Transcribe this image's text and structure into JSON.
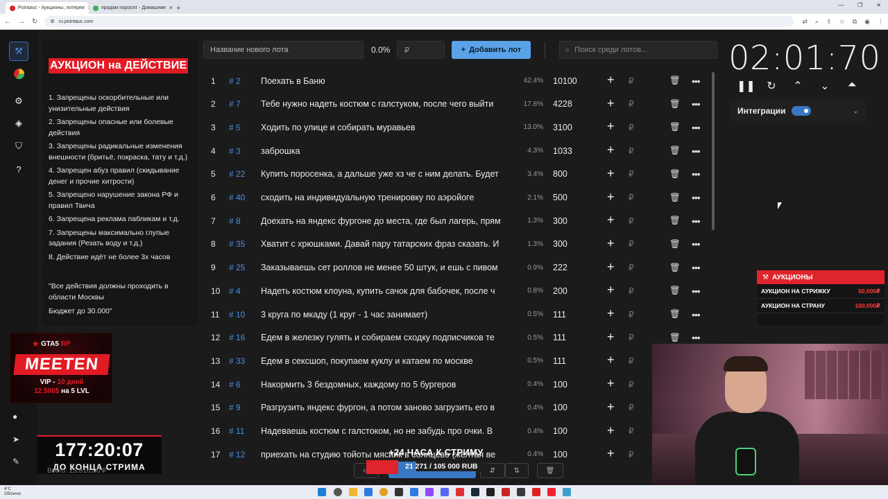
{
  "browser": {
    "tabs": [
      {
        "label": "Pointauc - Аукционы, лотереи",
        "active": true,
        "color": "#e0242c"
      },
      {
        "label": "продам поросят - Домашние",
        "active": false,
        "color": "#3fae5a"
      }
    ],
    "new_tab": "+",
    "url": "ru.pointauc.com",
    "window_controls": [
      "—",
      "❐",
      "✕"
    ]
  },
  "rail": {
    "items": [
      {
        "name": "auction-icon",
        "glyph": "🔨",
        "active": true
      },
      {
        "name": "wheel-icon",
        "glyph": "◕",
        "active": false
      },
      {
        "name": "gear-icon",
        "glyph": "⚙",
        "active": false
      },
      {
        "name": "layers-icon",
        "glyph": "◈",
        "active": false
      },
      {
        "name": "shield-icon",
        "glyph": "⛉",
        "active": false
      },
      {
        "name": "help-icon",
        "glyph": "?",
        "active": false
      }
    ],
    "bottom": [
      {
        "name": "github-icon",
        "glyph": "●"
      },
      {
        "name": "telegram-icon",
        "glyph": "➤"
      },
      {
        "name": "donate-icon",
        "glyph": "✎"
      }
    ]
  },
  "rules": {
    "title": "АУКЦИОН на ДЕЙСТВИЕ",
    "items": [
      "1. Запрещены оскорбительные или унизительные действия",
      "2. Запрещены опасные или болевые действия",
      "3. Запрещены радикальные изменения внешности (бритьё, покраска, тату и т.д.)",
      "4. Запрещен абуз правил (скидывание денег и прочие хитрости)",
      "5. Запрещено нарушение закона РФ и правил Твича",
      "6. Запрещена реклама пабликам и т.д.",
      "7.  Запрещены максимально глупые задания (Резать воду и т.д.)",
      "8. Действие идёт не более 3х часов"
    ],
    "quote": "\"Все действия должны проходить в области Москвы",
    "budget": "Бюджет до 30.000\""
  },
  "promo": {
    "gta": "GTA5",
    "rp": "RP",
    "name": "MEETEN",
    "vip_line1_a": "VIP - ",
    "vip_line1_b": "10 дней",
    "vip_line2_a": "12.500$",
    "vip_line2_b": " на 5 LVL"
  },
  "stream": {
    "countdown": "177:20:07",
    "caption": "ДО КОНЦА СТРИМА",
    "total": "Всего: 23.816,00 ₽"
  },
  "toolbar": {
    "name_placeholder": "Название нового лота",
    "percent": "0.0%",
    "rub_placeholder": "₽",
    "add_label": "Добавить лот",
    "search_placeholder": "Поиск среди лотов..."
  },
  "lots": [
    {
      "n": "1",
      "id": "# 2",
      "name": "Поехать в Баню",
      "pct": "42.4%",
      "amount": "10100"
    },
    {
      "n": "2",
      "id": "# 7",
      "name": "Тебе нужно надеть костюм с галстуком, после чего выйти",
      "pct": "17.8%",
      "amount": "4228"
    },
    {
      "n": "3",
      "id": "# 5",
      "name": "Ходить по улице и собирать муравьев",
      "pct": "13.0%",
      "amount": "3100"
    },
    {
      "n": "4",
      "id": "# 3",
      "name": "заброшка",
      "pct": "4.3%",
      "amount": "1033"
    },
    {
      "n": "5",
      "id": "# 22",
      "name": "Купить поросенка, а дальше уже хз че с ним делать. Будет",
      "pct": "3.4%",
      "amount": "800"
    },
    {
      "n": "6",
      "id": "# 40",
      "name": "сходить на индивидуальную тренировку по аэройоге",
      "pct": "2.1%",
      "amount": "500"
    },
    {
      "n": "7",
      "id": "# 8",
      "name": "Доехать на яндекс фургоне до места, где был лагерь, прям",
      "pct": "1.3%",
      "amount": "300"
    },
    {
      "n": "8",
      "id": "# 35",
      "name": "Хватит с хрюшками. Давай пару татарских фраз сказать. И",
      "pct": "1.3%",
      "amount": "300"
    },
    {
      "n": "9",
      "id": "# 25",
      "name": "Заказываешь сет роллов не менее 50 штук, и ешь с пивом",
      "pct": "0.9%",
      "amount": "222"
    },
    {
      "n": "10",
      "id": "# 4",
      "name": "Надеть костюм клоуна, купить сачок для бабочек, после ч",
      "pct": "0.8%",
      "amount": "200"
    },
    {
      "n": "11",
      "id": "# 10",
      "name": "3 круга по мкаду (1 круг - 1 час занимает)",
      "pct": "0.5%",
      "amount": "111"
    },
    {
      "n": "12",
      "id": "# 16",
      "name": "Едем в железку гулять и собираем сходку подписчиков те",
      "pct": "0.5%",
      "amount": "111"
    },
    {
      "n": "13",
      "id": "# 33",
      "name": "Едем в сексшоп, покупаем куклу и катаем по москве",
      "pct": "0.5%",
      "amount": "111"
    },
    {
      "n": "14",
      "id": "# 6",
      "name": "Накормить 3 бездомных, каждому по 5 бургеров",
      "pct": "0.4%",
      "amount": "100"
    },
    {
      "n": "15",
      "id": "# 9",
      "name": "Разгрузить яндекс фургон, а потом заново загрузить его в",
      "pct": "0.4%",
      "amount": "100"
    },
    {
      "n": "16",
      "id": "# 11",
      "name": "Надеваешь костюм с галстоком, но не забудь про очки. В",
      "pct": "0.4%",
      "amount": "100"
    },
    {
      "n": "17",
      "id": "# 12",
      "name": "приехать на студию тойоты мясиик в солнцево (желтая ве",
      "pct": "0.4%",
      "amount": "100"
    }
  ],
  "row_actions": {
    "plus": "+",
    "rub": "₽",
    "delete": "🗑",
    "more": "•••"
  },
  "timer": {
    "value": "02:01:70",
    "controls": [
      {
        "name": "pause-icon",
        "glyph": "❚❚"
      },
      {
        "name": "restart-icon",
        "glyph": "↻"
      },
      {
        "name": "chevron-up-icon",
        "glyph": "⌃"
      },
      {
        "name": "chevron-down-icon",
        "glyph": "⌄"
      },
      {
        "name": "double-up-icon",
        "glyph": "⏶"
      }
    ]
  },
  "integrations": {
    "label": "Интеграции",
    "chevron": "⌄",
    "enabled": true
  },
  "auctions_widget": {
    "title": "АУКЦИОНЫ",
    "rows": [
      {
        "label": "АУКЦИОН НА СТРИЖКУ",
        "value": "50,000₽"
      },
      {
        "label": "АУКЦИОН НА СТРАНУ",
        "value": "100,000₽"
      }
    ]
  },
  "overlay": {
    "promo_line": "+24 ЧАСА К СТРИМУ",
    "progress_text": "21 271 / 105 000 RUB",
    "progress_fraction": 0.2026
  },
  "taskbar": {
    "weather_temp": "4°C",
    "weather_text": "Облачно"
  },
  "colors": {
    "accent": "#4a90e2",
    "brand_red": "#e0242c",
    "button": "#5aa3e8"
  }
}
